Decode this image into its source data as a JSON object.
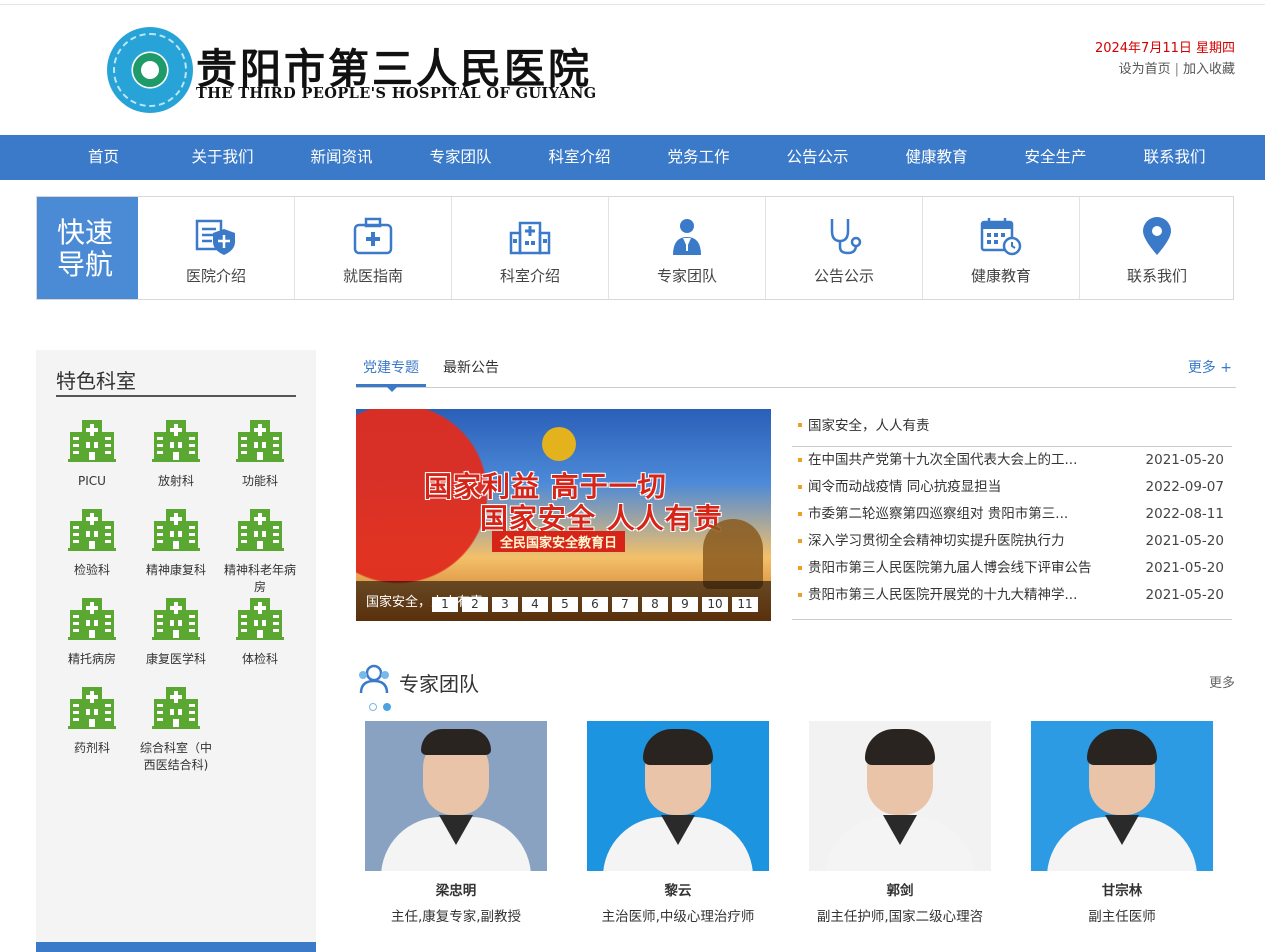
{
  "header": {
    "name_cn": "贵阳市第三人民医院",
    "name_en": "THE THIRD PEOPLE'S HOSPITAL OF GUIYANG",
    "date": "2024年7月11日 星期四",
    "set_home": "设为首页",
    "separator": "|",
    "add_favorite": "加入收藏"
  },
  "nav": {
    "items": [
      "首页",
      "关于我们",
      "新闻资讯",
      "专家团队",
      "科室介绍",
      "党务工作",
      "公告公示",
      "健康教育",
      "安全生产",
      "联系我们"
    ]
  },
  "quick_nav": {
    "title_line1": "快速",
    "title_line2": "导航",
    "items": [
      {
        "label": "医院介绍",
        "icon": "hospital-intro-icon"
      },
      {
        "label": "就医指南",
        "icon": "medical-kit-icon"
      },
      {
        "label": "科室介绍",
        "icon": "hospital-building-icon"
      },
      {
        "label": "专家团队",
        "icon": "doctor-icon"
      },
      {
        "label": "公告公示",
        "icon": "stethoscope-icon"
      },
      {
        "label": "健康教育",
        "icon": "calendar-clock-icon"
      },
      {
        "label": "联系我们",
        "icon": "location-pin-icon"
      }
    ]
  },
  "departments": {
    "title": "特色科室",
    "items": [
      "PICU",
      "放射科",
      "功能科",
      "检验科",
      "精神康复科",
      "精神科老年病房",
      "精托病房",
      "康复医学科",
      "体检科",
      "药剂科",
      "综合科室（中西医结合科)"
    ]
  },
  "news": {
    "tabs": [
      "党建专题",
      "最新公告"
    ],
    "more": "更多 +",
    "top_item": "国家安全，人人有责",
    "items": [
      {
        "title": "在中国共产党第十九次全国代表大会上的工...",
        "date": "2021-05-20"
      },
      {
        "title": "闻令而动战疫情 同心抗疫显担当",
        "date": "2022-09-07"
      },
      {
        "title": "市委第二轮巡察第四巡察组对 贵阳市第三...",
        "date": "2022-08-11"
      },
      {
        "title": "深入学习贯彻全会精神切实提升医院执行力",
        "date": "2021-05-20"
      },
      {
        "title": "贵阳市第三人民医院第九届人博会线下评审公告",
        "date": "2021-05-20"
      },
      {
        "title": "贵阳市第三人民医院开展党的十九大精神学...",
        "date": "2021-05-20"
      }
    ]
  },
  "slider": {
    "line1": "国家利益 高于一切",
    "line2": "国家安全 人人有责",
    "line3": "全民国家安全教育日",
    "caption": "国家安全，人人有责",
    "pages": [
      "1",
      "2",
      "3",
      "4",
      "5",
      "6",
      "7",
      "8",
      "9",
      "10",
      "11"
    ],
    "active_page": 2
  },
  "experts": {
    "title": "专家团队",
    "more": "更多",
    "carousel_pages": 2,
    "active_page": 2,
    "items": [
      {
        "name": "梁忠明",
        "title": "主任,康复专家,副教授",
        "bg": "#8aa2c2"
      },
      {
        "name": "黎云",
        "title": "主治医师,中级心理治疗师",
        "bg": "#1d94e0"
      },
      {
        "name": "郭剑",
        "title": "副主任护师,国家二级心理咨",
        "bg": "#f2f2f2"
      },
      {
        "name": "甘宗林",
        "title": "副主任医师",
        "bg": "#2c9be3"
      }
    ]
  },
  "colors": {
    "nav_bg": "#3b7ac9",
    "accent": "#3b7ac9",
    "date_red": "#d40000",
    "dept_icon_green": "#5aa832",
    "bullet": "#f0a020"
  }
}
